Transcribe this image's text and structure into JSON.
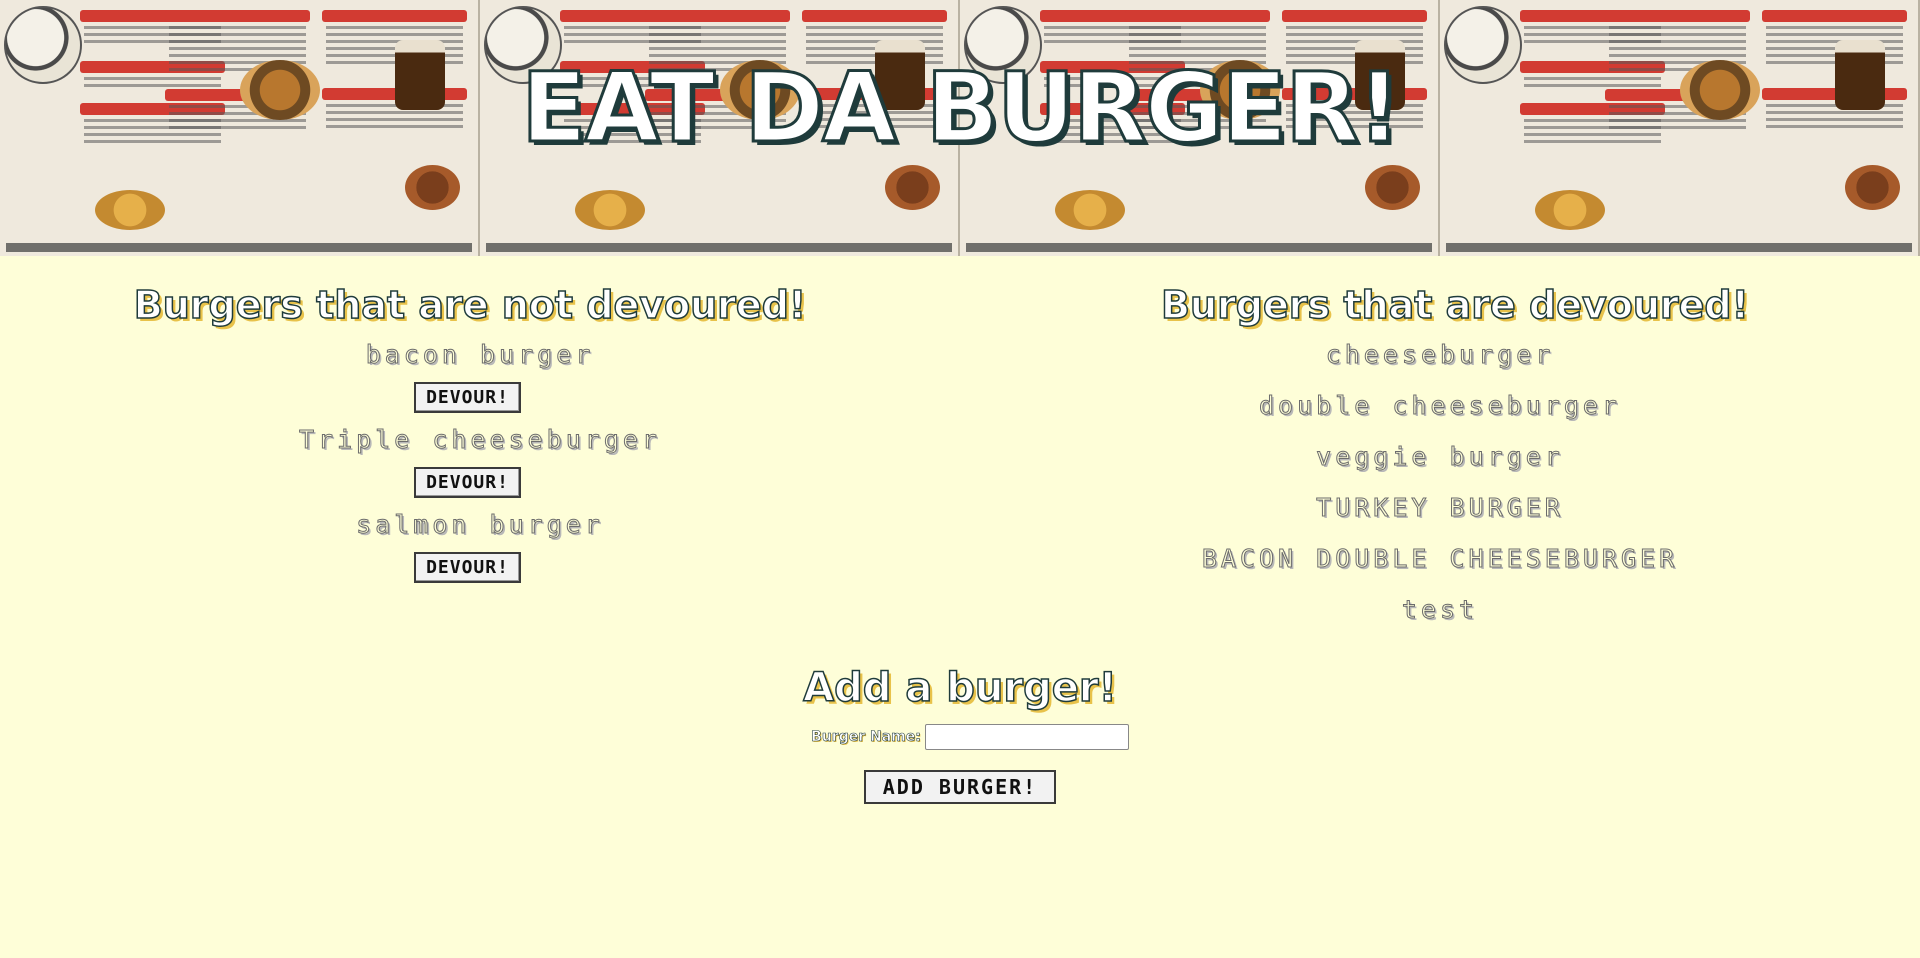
{
  "header": {
    "title": "EAT DA BURGER!"
  },
  "not_devoured": {
    "title": "Burgers that are not devoured!",
    "devour_label": "DEVOUR!",
    "items": [
      {
        "name": "bacon burger"
      },
      {
        "name": "Triple cheeseburger"
      },
      {
        "name": "salmon burger"
      }
    ]
  },
  "devoured": {
    "title": "Burgers that are devoured!",
    "items": [
      {
        "name": "cheeseburger"
      },
      {
        "name": "double cheeseburger"
      },
      {
        "name": "veggie burger"
      },
      {
        "name": "TURKEY BURGER"
      },
      {
        "name": "BACON DOUBLE CHEESEBURGER"
      },
      {
        "name": "test"
      }
    ]
  },
  "add_form": {
    "title": "Add a burger!",
    "label": "Burger Name:",
    "value": "",
    "button_label": "ADD BURGER!"
  },
  "colors": {
    "background": "#fefed8",
    "title_outline": "#1f3b3b",
    "title_shadow": "#e8c24a",
    "menu_red": "#d23b32"
  }
}
